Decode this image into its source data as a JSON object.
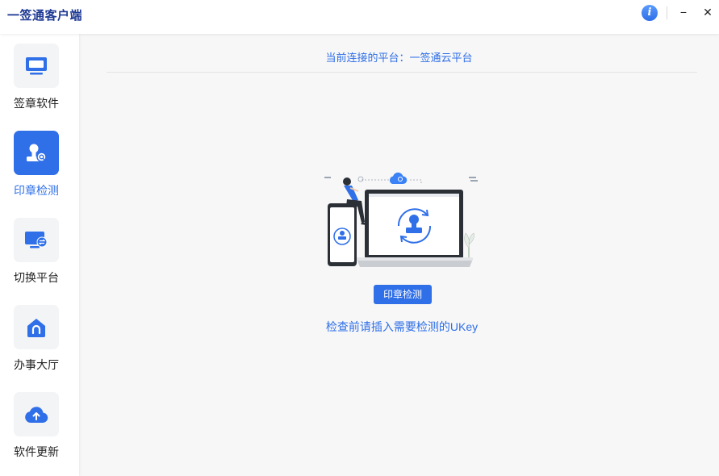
{
  "app": {
    "title": "一签通客户端",
    "info_glyph": "i",
    "minimize_glyph": "−",
    "close_glyph": "✕"
  },
  "sidebar": {
    "items": [
      {
        "label": "签章软件",
        "icon": "monitor-icon",
        "active": false
      },
      {
        "label": "印章检测",
        "icon": "stamp-search-icon",
        "active": true
      },
      {
        "label": "切换平台",
        "icon": "switch-platform-icon",
        "active": false
      },
      {
        "label": "办事大厅",
        "icon": "home-icon",
        "active": false
      },
      {
        "label": "软件更新",
        "icon": "cloud-upload-icon",
        "active": false
      }
    ]
  },
  "main": {
    "platform_text": "当前连接的平台：一签通云平台",
    "detect_button": "印章检测",
    "hint": "检查前请插入需要检测的UKey"
  },
  "colors": {
    "accent": "#2f6fe8",
    "brand_title": "#1f3a93"
  }
}
